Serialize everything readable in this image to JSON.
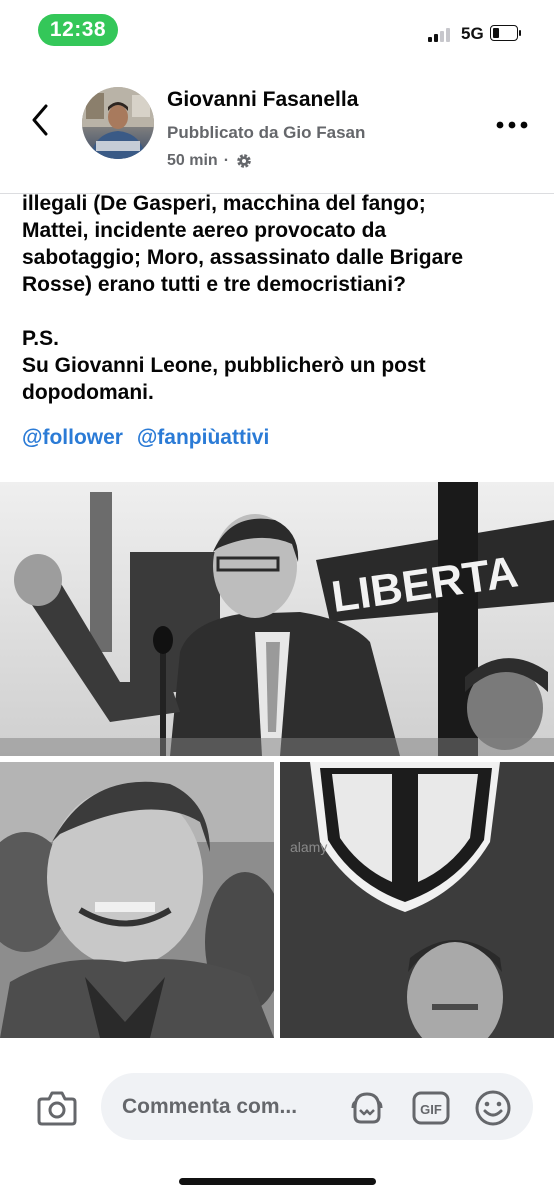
{
  "status_bar": {
    "time": "12:38",
    "network": "5G",
    "battery_percent": 20
  },
  "header": {
    "title": "Giovanni Fasanella",
    "subtitle": "Pubblicato da Gio Fasan",
    "time": "50 min",
    "separator": "·",
    "icons": {
      "back": "chevron-left-icon",
      "privacy": "gear-icon",
      "more": "more-horizontal-icon"
    }
  },
  "post": {
    "lines": [
      "illegali (De Gasperi, macchina del fango;",
      "Mattei, incidente aereo provocato da",
      "sabotaggio; Moro, assassinato dalle Brigare",
      "Rosse) erano tutti e tre democristiani?"
    ],
    "ps_label": "P.S.",
    "ps_lines": [
      "Su Giovanni Leone, pubblicherò un post",
      "dopodomani."
    ],
    "tags": [
      "@follower",
      "@fanpiùattivi"
    ]
  },
  "photos": {
    "main_banner_text": "LIBERTA",
    "watermark": "alamy"
  },
  "comment_bar": {
    "placeholder": "Commenta com...",
    "gif_label": "GIF",
    "icons": [
      "camera-icon",
      "avatar-sticker-icon",
      "gif-icon",
      "emoji-icon"
    ]
  }
}
